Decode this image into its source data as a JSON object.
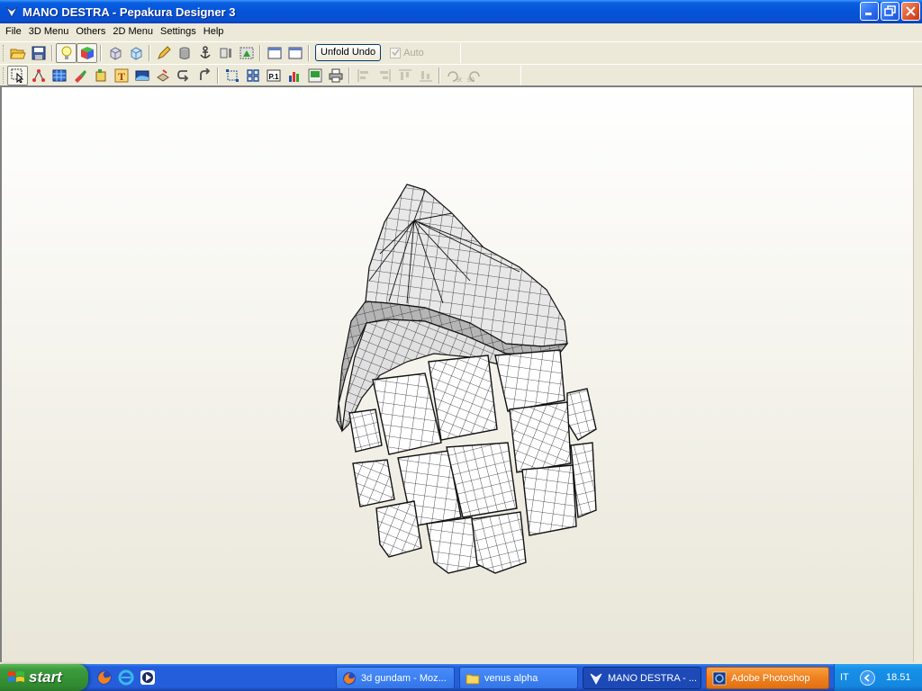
{
  "window": {
    "title": "MANO DESTRA - Pepakura Designer 3"
  },
  "menu": [
    "File",
    "3D Menu",
    "Others",
    "2D Menu",
    "Settings",
    "Help"
  ],
  "toolbar": {
    "unfold_undo_label": "Unfold Undo",
    "auto_label": "Auto"
  },
  "taskbar": {
    "start_label": "start",
    "tasks": [
      {
        "label": "3d gundam - Moz...",
        "icon": "firefox-icon"
      },
      {
        "label": "venus alpha",
        "icon": "folder-icon"
      },
      {
        "label": "MANO DESTRA - ...",
        "icon": "pepakura-icon"
      },
      {
        "label": "Adobe Photoshop",
        "icon": "photoshop-icon"
      }
    ],
    "language": "IT",
    "clock": "18.51"
  },
  "colors": {
    "titlebar": "#0553d8",
    "taskbar": "#245edb",
    "start": "#3c9c3c",
    "photoshop_task": "#f08020"
  }
}
